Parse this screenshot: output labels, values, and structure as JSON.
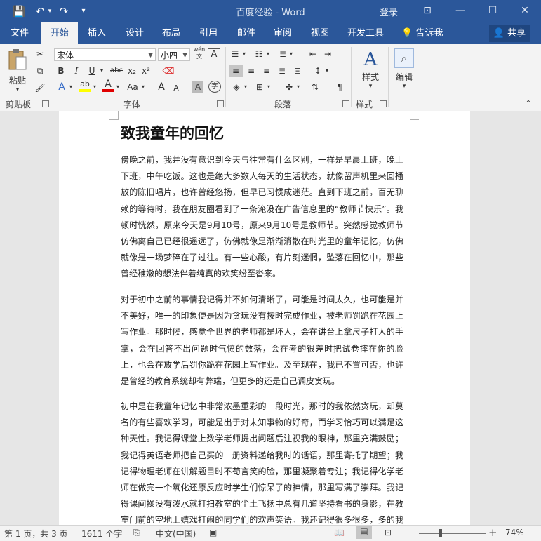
{
  "window": {
    "title": "百度经验 - Word",
    "login_label": "登录"
  },
  "quick_access": {
    "save": "💾",
    "undo": "↶",
    "redo": "↷",
    "customize": "▾"
  },
  "window_controls": {
    "ribbon_options": "⊡",
    "minimize": "—",
    "maximize": "☐",
    "close": "✕"
  },
  "tabs": [
    "文件",
    "开始",
    "插入",
    "设计",
    "布局",
    "引用",
    "邮件",
    "审阅",
    "视图",
    "开发工具"
  ],
  "active_tab": "开始",
  "tell_me": "告诉我",
  "share_label": "共享",
  "ribbon": {
    "clipboard": {
      "paste_label": "粘贴",
      "group_label": "剪贴板"
    },
    "font": {
      "group_label": "字体",
      "font_name": "宋体",
      "font_size": "小四",
      "wen_label": "wén",
      "char_border": "A",
      "bold": "B",
      "italic": "I",
      "underline": "U",
      "strike": "abc",
      "subscript": "x₂",
      "superscript": "x²",
      "text_effects": "A",
      "highlight": "ab",
      "font_color": "A",
      "change_case": "Aa",
      "grow": "A",
      "shrink": "A",
      "char_shading": "A",
      "enclose": "字"
    },
    "paragraph": {
      "group_label": "段落"
    },
    "styles": {
      "button_label": "样式",
      "group_label": "样式"
    },
    "editing": {
      "button_label": "编辑"
    }
  },
  "document": {
    "title": "致我童年的回忆",
    "paragraphs": [
      "傍晚之前，我并没有意识到今天与往常有什么区别，一样是早晨上班，晚上下班，中午吃饭。这也是绝大多数人每天的生活状态，就像留声机里来回播放的陈旧唱片，也许曾经悠扬，但早已习惯成迷茫。直到下班之前，百无聊赖的等待时，我在朋友圈看到了一条淹没在广告信息里的“教师节快乐”。我顿时恍然，原来今天是9月10号，原来9月10号是教师节。突然感觉教师节仿佛离自己已经很遥远了，仿佛就像是渐渐消散在时光里的童年记忆，仿佛就像是一场梦碎在了过往。有一些心酸，有片刻迷惘，坠落在回忆中，那些曾经稚嫩的想法伴着纯真的欢笑纷至沓来。",
      "对于初中之前的事情我记得并不如何清晰了，可能是时间太久，也可能是并不美好，唯一的印象便是因为贪玩没有按时完成作业，被老师罚跪在花园上写作业。那时候，感觉全世界的老师都是坏人，会在讲台上拿尺子打人的手掌，会在回答不出问题时气愤的数落，会在考的很差时把试卷摔在你的脸上，也会在放学后罚你跪在花园上写作业。及至现在，我已不置可否，也许是曾经的教育系统却有弊端，但更多的还是自己调皮贪玩。",
      "初中是在我童年记忆中非常浓墨重彩的一段时光，那时的我依然贪玩，却莫名的有些喜欢学习，可能是出于对未知事物的好奇，而学习恰巧可以满足这种天性。我记得课堂上数学老师提出问题后注视我的眼神，那里充满鼓励；我记得英语老师把自己买的一册资料递给我时的话语，那里寄托了期望；我记得物理老师在讲解题目时不苟言笑的脸，那里凝聚着专注；我记得化学老师在做完一个氧化还原反应时学生们惊呆了的神情，那里写满了崇拜。我记得课间操没有泼水就打扫教室的尘土飞扬中总有几道坚持看书的身影，在教室门前的空地上嬉戏打闹的同学们的欢声笑语。我还记得很多很多，多的我数不过来，多"
    ]
  },
  "status_bar": {
    "page": "第 1 页，共 3 页",
    "words": "1611 个字",
    "language": "中文(中国)",
    "zoom": "74%",
    "zoom_out": "—",
    "zoom_in": "+"
  },
  "colors": {
    "accent": "#2b579a",
    "highlight": "#ffff00",
    "font_red": "#e00000"
  }
}
